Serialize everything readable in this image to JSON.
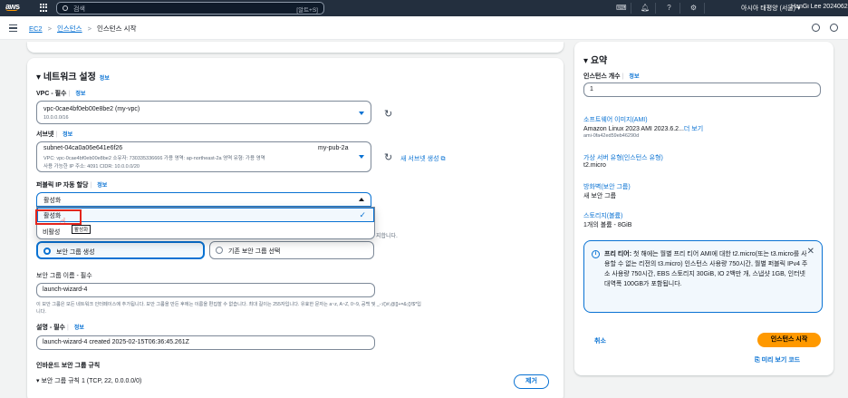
{
  "topbar": {
    "logo": "aws",
    "search_placeholder": "검색",
    "search_shortcut": "[알트+S]",
    "region": "아시아 태평양 (서울) ▾",
    "user": "HanGi Lee 2024062"
  },
  "breadcrumb": {
    "items": [
      "EC2",
      "인스턴스",
      "인스턴스 시작"
    ]
  },
  "network": {
    "title": "네트워크 설정",
    "info": "정보",
    "vpc_label": "VPC - 필수",
    "vpc_value": "vpc-0cae4bf0eb00e8be2 (my-vpc)",
    "vpc_sub": "10.0.0.0/16",
    "subnet_label": "서브넷",
    "subnet_value": "subnet-04ca0a06e641e6f26",
    "subnet_name": "my-pub-2a",
    "subnet_detail1": "VPC: vpc-0cae4bf0eb00e8be2    소유자: 730335336666    가용 영역: ap-northeast-2a    영역 유형: 가용 영역",
    "subnet_detail2": "사용 가능한 IP 주소: 4091    CIDR: 10.0.0.0/20",
    "new_subnet_link": "새 서브넷 생성",
    "public_ip_label": "퍼블릭 IP 자동 할당",
    "public_ip_value": "활성화",
    "options": [
      "활성화",
      "비활성"
    ],
    "tooltip": "활성화",
    "hint_text": "지합니다.",
    "sg_create": "보안 그룹 생성",
    "sg_existing": "기존 보안 그룹 선택",
    "sg_name_label": "보안 그룹 이름 - 필수",
    "sg_name_value": "launch-wizard-4",
    "sg_name_hint1": "이 보안 그룹은 모든 네트워크 인터페이스에 추가됩니다. 보안 그룹을 만든 후에는 이름을 편집할 수 없습니다. 최대 길이는 255자입니다. 유효한 문자는 a~z, A~Z, 0~9, 공백 및 _-:/()#,@[]+=&;{}!$*입",
    "sg_name_hint2": "니다.",
    "desc_label": "설명 - 필수",
    "desc_value": "launch-wizard-4 created 2025-02-15T06:36:45.261Z",
    "inbound_label": "인바운드 보안 그룹 규칙",
    "rule_label": "보안 그룹 규칙 1 (TCP, 22, 0.0.0.0/0)",
    "remove_button": "제거"
  },
  "summary": {
    "title": "요약",
    "instances_label": "인스턴스 개수",
    "info": "정보",
    "instances_value": "1",
    "ami_label": "소프트웨어 이미지(AMI)",
    "ami_value": "Amazon Linux 2023 AMI 2023.6.2...",
    "ami_more": "더 보기",
    "ami_id": "ami-0fa42ed59eb46290d",
    "type_label": "가상 서버 유형(인스턴스 유형)",
    "type_value": "t2.micro",
    "fw_label": "방화벽(보안 그룹)",
    "fw_value": "새 보안 그룹",
    "storage_label": "스토리지(볼륨)",
    "storage_value": "1개의 볼륨 - 8GiB",
    "free_tier_title": "프리 티어:",
    "free_tier_text": "첫 해에는 월별 프리 티어 AMI에 대한 t2.micro(또는 t3.micro를 사용할 수 없는 리전의 t3.micro) 인스턴스 사용량 750시간, 월별 퍼블릭 IPv4 주소 사용량 750시간, EBS 스토리지 30GiB, IO 2백만 개, 스냅샷 1GB, 인터넷 대역폭 100GB가 포함됩니다.",
    "cancel": "취소",
    "launch": "인스턴스 시작",
    "preview": "미리 보기 코드"
  },
  "colors": {
    "accent": "#0972d3",
    "launch_button": "#ff9900",
    "topbar": "#232f3e",
    "highlight_box": "#e3251c"
  }
}
